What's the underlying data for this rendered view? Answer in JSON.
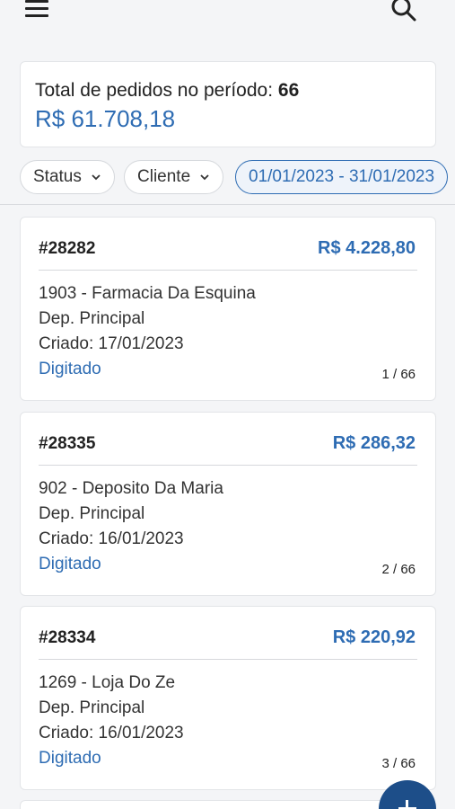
{
  "topbar": {
    "menu_icon": "hamburger-menu-icon",
    "search_icon": "search-icon"
  },
  "summary": {
    "label": "Total de pedidos no período:",
    "count": "66",
    "total": "R$ 61.708,18"
  },
  "filters": {
    "status_label": "Status",
    "cliente_label": "Cliente",
    "date_range": "01/01/2023 - 31/01/2023"
  },
  "orders": [
    {
      "number": "#28282",
      "amount": "R$ 4.228,80",
      "client": "1903 - Farmacia Da Esquina",
      "deposit": "Dep. Principal",
      "created": "Criado: 17/01/2023",
      "status": "Digitado",
      "position": "1 / 66"
    },
    {
      "number": "#28335",
      "amount": "R$ 286,32",
      "client": "902 - Deposito Da Maria",
      "deposit": "Dep. Principal",
      "created": "Criado: 16/01/2023",
      "status": "Digitado",
      "position": "2 / 66"
    },
    {
      "number": "#28334",
      "amount": "R$ 220,92",
      "client": "1269 - Loja Do Ze",
      "deposit": "Dep. Principal",
      "created": "Criado: 16/01/2023",
      "status": "Digitado",
      "position": "3 / 66"
    }
  ],
  "fab_icon": "plus-icon",
  "colors": {
    "accent": "#2e6cb3",
    "fab": "#1d4e89",
    "background": "#f4f5f7"
  }
}
